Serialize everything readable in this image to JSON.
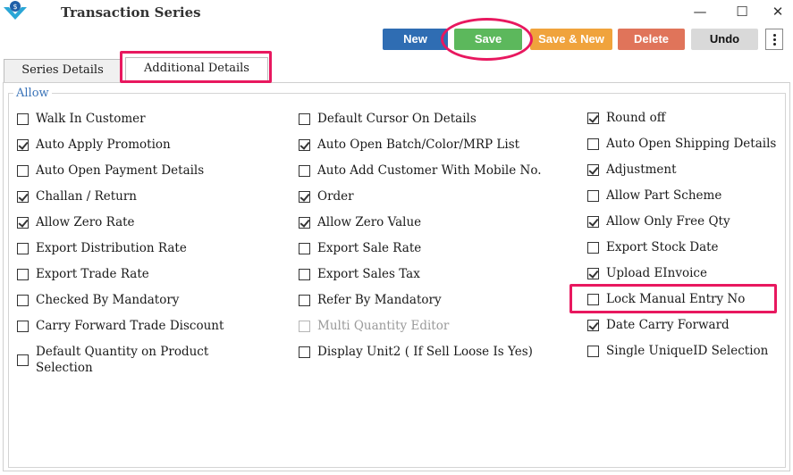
{
  "window": {
    "title": "Transaction Series"
  },
  "toolbar": {
    "new_label": "New",
    "save_label": "Save",
    "save_new_label": "Save & New",
    "delete_label": "Delete",
    "undo_label": "Undo"
  },
  "tabs": [
    {
      "label": "Series Details"
    },
    {
      "label": "Additional Details"
    }
  ],
  "group": {
    "title": "Allow"
  },
  "columns": [
    [
      {
        "label": "Walk In Customer",
        "checked": false
      },
      {
        "label": "Auto Apply Promotion",
        "checked": true
      },
      {
        "label": "Auto Open Payment Details",
        "checked": false
      },
      {
        "label": "Challan / Return",
        "checked": true
      },
      {
        "label": "Allow Zero Rate",
        "checked": true
      },
      {
        "label": "Export Distribution Rate",
        "checked": false
      },
      {
        "label": "Export Trade Rate",
        "checked": false
      },
      {
        "label": "Checked By Mandatory",
        "checked": false
      },
      {
        "label": "Carry Forward Trade Discount",
        "checked": false
      },
      {
        "label": "Default Quantity on Product Selection",
        "checked": false
      }
    ],
    [
      {
        "label": "Default Cursor On Details",
        "checked": false
      },
      {
        "label": "Auto Open Batch/Color/MRP List",
        "checked": true
      },
      {
        "label": "Auto Add Customer With Mobile No.",
        "checked": false
      },
      {
        "label": "Order",
        "checked": true
      },
      {
        "label": "Allow Zero Value",
        "checked": true
      },
      {
        "label": "Export Sale Rate",
        "checked": false
      },
      {
        "label": "Export Sales Tax",
        "checked": false
      },
      {
        "label": "Refer By Mandatory",
        "checked": false
      },
      {
        "label": "Multi Quantity Editor",
        "checked": false,
        "disabled": true
      },
      {
        "label": "Display Unit2 ( If Sell Loose Is Yes)",
        "checked": false
      }
    ],
    [
      {
        "label": "Round off",
        "checked": true
      },
      {
        "label": "Auto Open Shipping Details",
        "checked": false
      },
      {
        "label": "Adjustment",
        "checked": true
      },
      {
        "label": "Allow Part Scheme",
        "checked": false
      },
      {
        "label": "Allow Only Free Qty",
        "checked": true
      },
      {
        "label": "Export Stock Date",
        "checked": false
      },
      {
        "label": "Upload EInvoice",
        "checked": true
      },
      {
        "label": "Lock Manual Entry No",
        "checked": false
      },
      {
        "label": "Date Carry Forward",
        "checked": true
      },
      {
        "label": "Single UniqueID Selection",
        "checked": false
      }
    ]
  ],
  "colors": {
    "highlight": "#e8185f",
    "new": "#2f6db3",
    "save": "#5cb85c",
    "save_new": "#f0a33c",
    "delete": "#e0745a",
    "undo": "#d9d9d9"
  }
}
